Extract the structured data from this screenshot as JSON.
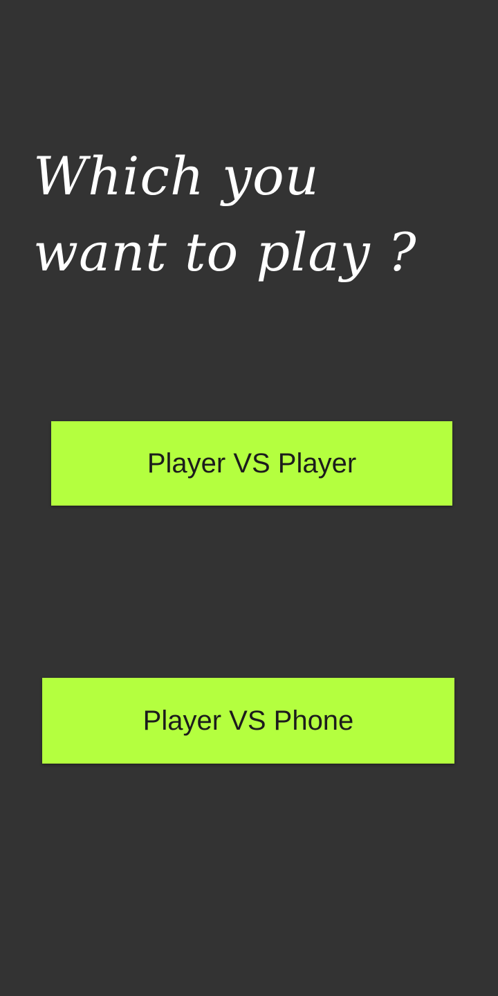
{
  "screen": {
    "title": "Which you want to play ?"
  },
  "buttons": {
    "player_vs_player": "Player VS Player",
    "player_vs_phone": "Player VS Phone"
  },
  "colors": {
    "background": "#333333",
    "button": "#b4ff3f",
    "button_text": "#1c1c1c",
    "title_text": "#ffffff"
  }
}
